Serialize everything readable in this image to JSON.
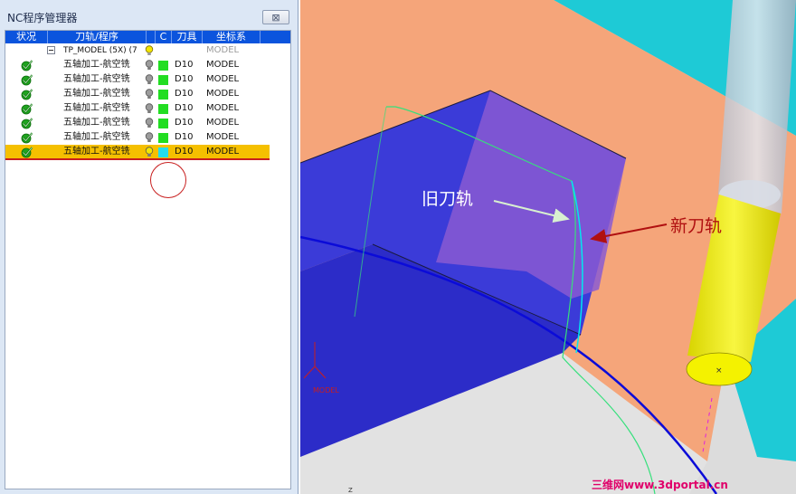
{
  "panel": {
    "title": "NC程序管理器",
    "close_label": "⊠"
  },
  "columns": {
    "status": "状况",
    "toolpath": "刀轨/程序",
    "c": "C",
    "tool": "刀具",
    "coord": "坐标系"
  },
  "group": {
    "name": "TP_MODEL (5X) (7",
    "coord": "MODEL"
  },
  "rows": [
    {
      "name": "五轴加工-航空铣",
      "tool": "D10",
      "coord": "MODEL",
      "color": "#22dd22"
    },
    {
      "name": "五轴加工-航空铣",
      "tool": "D10",
      "coord": "MODEL",
      "color": "#22dd22"
    },
    {
      "name": "五轴加工-航空铣",
      "tool": "D10",
      "coord": "MODEL",
      "color": "#22dd22"
    },
    {
      "name": "五轴加工-航空铣",
      "tool": "D10",
      "coord": "MODEL",
      "color": "#22dd22"
    },
    {
      "name": "五轴加工-航空铣",
      "tool": "D10",
      "coord": "MODEL",
      "color": "#22dd22"
    },
    {
      "name": "五轴加工-航空铣",
      "tool": "D10",
      "coord": "MODEL",
      "color": "#22dd22"
    },
    {
      "name": "五轴加工-航空铣",
      "tool": "D10",
      "coord": "MODEL",
      "color": "#22ddee"
    }
  ],
  "viewport": {
    "old_path_label": "旧刀轨",
    "new_path_label": "新刀轨",
    "watermark": "三维网www.3dportal.cn",
    "axis_label": "MODEL",
    "bottom_tick": "Z"
  },
  "icons": {
    "status": "check-circle-icon",
    "bulb": "light-bulb-icon",
    "close": "close-icon",
    "expand": "minus-box-icon"
  },
  "colors": {
    "header": "#0b54dd",
    "selected": "#f5c000",
    "arrow_new": "#b01010",
    "arrow_old": "#d8f0d0"
  }
}
